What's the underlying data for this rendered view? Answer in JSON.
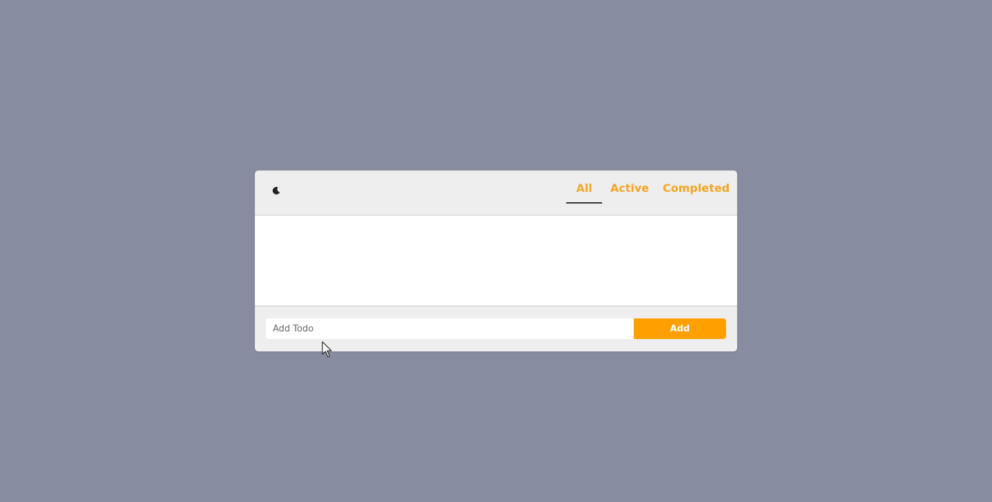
{
  "header": {
    "theme_icon": "moon-icon",
    "tabs": [
      {
        "label": "All",
        "selected": true
      },
      {
        "label": "Active",
        "selected": false
      },
      {
        "label": "Completed",
        "selected": false
      }
    ]
  },
  "list": {
    "items": []
  },
  "footer": {
    "input_placeholder": "Add Todo",
    "input_value": "",
    "add_label": "Add"
  },
  "colors": {
    "background": "#888ca1",
    "card": "#eeeeee",
    "accent": "#ffa000",
    "tab_text": "#f5a623"
  }
}
